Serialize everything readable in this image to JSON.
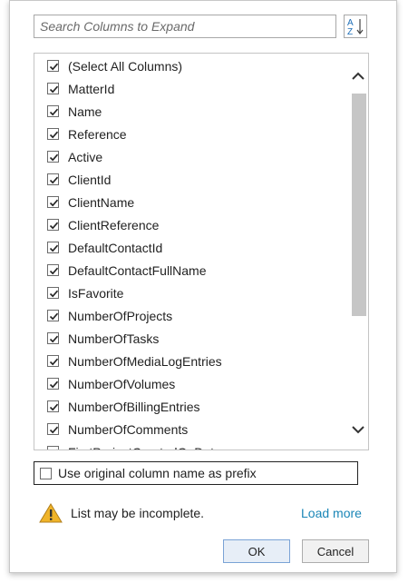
{
  "search": {
    "placeholder": "Search Columns to Expand"
  },
  "sort_button": {
    "icon": "sort-az-icon",
    "label_top": "A",
    "label_bottom": "Z"
  },
  "columns": [
    {
      "label": "(Select All Columns)",
      "checked": true
    },
    {
      "label": "MatterId",
      "checked": true
    },
    {
      "label": "Name",
      "checked": true
    },
    {
      "label": "Reference",
      "checked": true
    },
    {
      "label": "Active",
      "checked": true
    },
    {
      "label": "ClientId",
      "checked": true
    },
    {
      "label": "ClientName",
      "checked": true
    },
    {
      "label": "ClientReference",
      "checked": true
    },
    {
      "label": "DefaultContactId",
      "checked": true
    },
    {
      "label": "DefaultContactFullName",
      "checked": true
    },
    {
      "label": "IsFavorite",
      "checked": true
    },
    {
      "label": "NumberOfProjects",
      "checked": true
    },
    {
      "label": "NumberOfTasks",
      "checked": true
    },
    {
      "label": "NumberOfMediaLogEntries",
      "checked": true
    },
    {
      "label": "NumberOfVolumes",
      "checked": true
    },
    {
      "label": "NumberOfBillingEntries",
      "checked": true
    },
    {
      "label": "NumberOfComments",
      "checked": true
    },
    {
      "label": "FirstProjectCreatedOnDate",
      "checked": true
    }
  ],
  "prefix_option": {
    "label": "Use original column name as prefix",
    "checked": false
  },
  "warning": {
    "text": "List may be incomplete.",
    "icon": "warning-icon"
  },
  "load_more": "Load more",
  "buttons": {
    "ok": "OK",
    "cancel": "Cancel"
  },
  "colors": {
    "link": "#1a86b7",
    "ok_border": "#7aa3d6",
    "warning": "#f0b429"
  }
}
